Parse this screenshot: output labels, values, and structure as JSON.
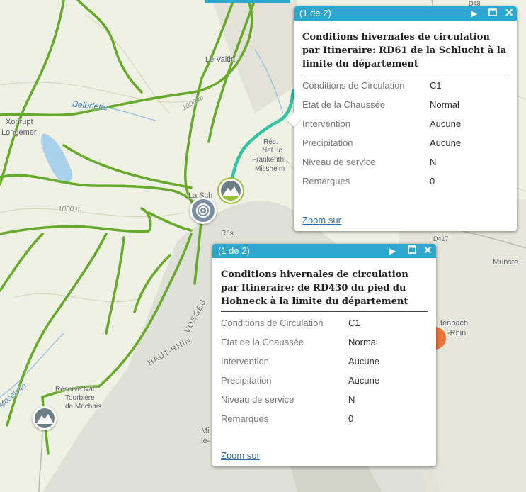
{
  "map": {
    "labels": {
      "le_valtin": "Le Valtin",
      "belbriette": "Belbriette",
      "xonrupt": "Xonrupt",
      "longemer": "Longemer",
      "contour_1000_a": "1000 m",
      "contour_1000_b": "1000 m",
      "res_nat_1": "Rés.",
      "res_nat_2": "Nat. le",
      "res_nat_3": "Frankenth.",
      "res_nat_4": "Missheim",
      "la_schlucht": "La Sch",
      "res_2": "Rés.",
      "vosges": "VOSGES",
      "haut_rhin": "HAUT-RHIN",
      "reserve_1": "Réserve Nat.",
      "reserve_2": "Tourbière",
      "reserve_3": "de Machais",
      "munster": "Munste",
      "tenbach_1": "tenbach",
      "tenbach_2": "-Rhin",
      "mi": "Mi",
      "le": "le-",
      "moselotte": "Moselotte",
      "d417": "D417",
      "d48": "D48"
    }
  },
  "popup1": {
    "pager": "(1 de 2)",
    "title": "Conditions hivernales de circulation par Itineraire: RD61 de la Schlucht à la limite du département",
    "rows": [
      {
        "label": "Conditions de Circulation",
        "value": "C1"
      },
      {
        "label": "Etat de la Chaussée",
        "value": "Normal"
      },
      {
        "label": "Intervention",
        "value": "Aucune"
      },
      {
        "label": "Precipitation",
        "value": "Aucune"
      },
      {
        "label": "Niveau de service",
        "value": "N"
      },
      {
        "label": "Remarques",
        "value": "0"
      }
    ],
    "zoom_label": "Zoom sur"
  },
  "popup2": {
    "pager": "(1 de 2)",
    "title": "Conditions hivernales de circulation par Itineraire: de RD430 du pied du Hohneck à la limite du département",
    "rows": [
      {
        "label": "Conditions de Circulation",
        "value": "C1"
      },
      {
        "label": "Etat de la Chaussée",
        "value": "Normal"
      },
      {
        "label": "Intervention",
        "value": "Aucune"
      },
      {
        "label": "Precipitation",
        "value": "Aucune"
      },
      {
        "label": "Niveau de service",
        "value": "N"
      },
      {
        "label": "Remarques",
        "value": "0"
      }
    ],
    "zoom_label": "Zoom sur"
  },
  "icons": {
    "next": "next-icon",
    "maximize": "maximize-icon",
    "close": "close-icon",
    "mountain": "mountain-icon",
    "target": "target-icon"
  },
  "colors": {
    "route": "#66a92b",
    "selected_route": "#35c3a6",
    "popup_header": "#2ea7cf",
    "link": "#2f6ea7",
    "marker_orange": "#e8743b"
  }
}
